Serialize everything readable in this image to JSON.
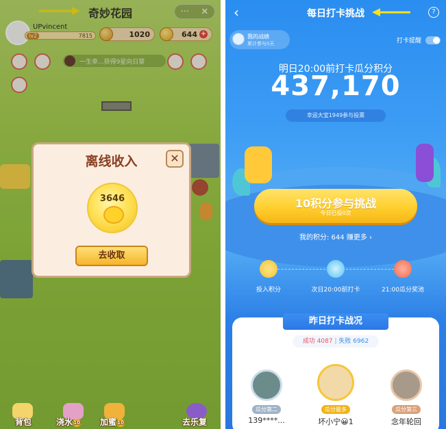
{
  "left": {
    "title": "奇妙花园",
    "capsule": {
      "more": "···",
      "close": "✕"
    },
    "user": {
      "name": "UPvincent",
      "level": "lv2",
      "exp": "7815"
    },
    "coins": {
      "honey": "1020",
      "gold": "644",
      "plus": "+"
    },
    "notice": "一生幸...获得9星向日葵",
    "modal": {
      "title": "离线收入",
      "close": "✕",
      "amount": "3646",
      "collect": "去收取"
    },
    "bottom": {
      "bag": "背包",
      "water": "浇水",
      "honey": "加蜜",
      "paradise": "去乐复",
      "water_badge": "10",
      "honey_badge": "10"
    }
  },
  "right": {
    "title": "每日打卡挑战",
    "back": "‹",
    "help": "?",
    "record": {
      "title": "我的战绩",
      "sub": "累计参与0天"
    },
    "remind": "打卡提醒",
    "subtitle": "明日20:00前打卡瓜分积分",
    "pool": "437,170",
    "voted": "幸运大宝1949参与投票",
    "join": {
      "label": "10积分参与挑战",
      "sub": "今日已投0次"
    },
    "my_points": "我的积分: 644  赚更多 ›",
    "steps": [
      "投入积分",
      "次日20:00前打卡",
      "21:00瓜分奖池"
    ],
    "results": {
      "title": "昨日打卡战况",
      "success_label": "成功",
      "success_value": "4087",
      "fail_label": "失败",
      "fail_value": "6962"
    },
    "leaders": [
      {
        "rank": "瓜分第二",
        "name": "139****..."
      },
      {
        "rank": "瓜分最多",
        "name": "坏小宁😀1"
      },
      {
        "rank": "瓜分第三",
        "name": "念年轮回"
      }
    ]
  },
  "colors": {
    "accent_blue": "#2a8df0",
    "gold": "#ffcf2e",
    "success": "#e8556c",
    "fail": "#3a8ee8"
  }
}
